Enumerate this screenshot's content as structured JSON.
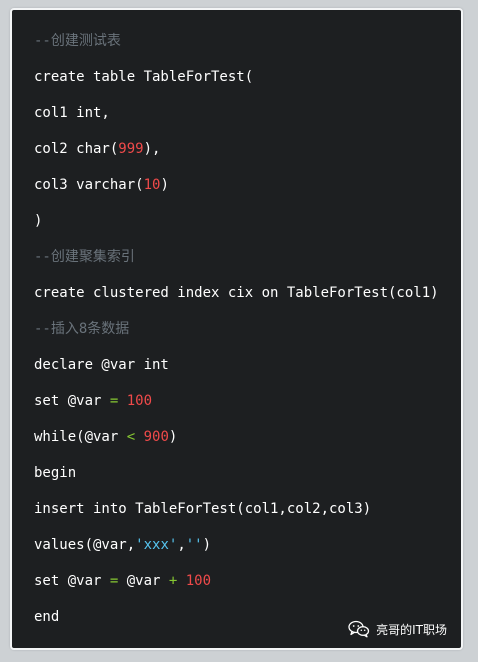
{
  "code": {
    "lines": [
      {
        "segments": [
          {
            "text": "--创建测试表",
            "type": "comment"
          }
        ]
      },
      {
        "segments": [
          {
            "text": "create table TableForTest(",
            "type": "plain"
          }
        ]
      },
      {
        "segments": [
          {
            "text": "col1 int,",
            "type": "plain"
          }
        ]
      },
      {
        "segments": [
          {
            "text": "col2 char(",
            "type": "plain"
          },
          {
            "text": "999",
            "type": "num"
          },
          {
            "text": "),",
            "type": "plain"
          }
        ]
      },
      {
        "segments": [
          {
            "text": "col3 varchar(",
            "type": "plain"
          },
          {
            "text": "10",
            "type": "num"
          },
          {
            "text": ")",
            "type": "plain"
          }
        ]
      },
      {
        "segments": [
          {
            "text": ")",
            "type": "plain"
          }
        ]
      },
      {
        "segments": [
          {
            "text": "--创建聚集索引",
            "type": "comment"
          }
        ]
      },
      {
        "segments": [
          {
            "text": "create clustered index cix on TableForTest(col1)",
            "type": "plain"
          }
        ]
      },
      {
        "segments": [
          {
            "text": "--插入8条数据",
            "type": "comment"
          }
        ]
      },
      {
        "segments": [
          {
            "text": "declare @var int",
            "type": "plain"
          }
        ]
      },
      {
        "segments": [
          {
            "text": "set @var ",
            "type": "plain"
          },
          {
            "text": "=",
            "type": "op"
          },
          {
            "text": " ",
            "type": "plain"
          },
          {
            "text": "100",
            "type": "num"
          }
        ]
      },
      {
        "segments": [
          {
            "text": "while(@var ",
            "type": "plain"
          },
          {
            "text": "<",
            "type": "op"
          },
          {
            "text": " ",
            "type": "plain"
          },
          {
            "text": "900",
            "type": "num"
          },
          {
            "text": ")",
            "type": "plain"
          }
        ]
      },
      {
        "segments": [
          {
            "text": "begin",
            "type": "plain"
          }
        ]
      },
      {
        "segments": [
          {
            "text": "insert into TableForTest(col1,col2,col3)",
            "type": "plain"
          }
        ]
      },
      {
        "segments": [
          {
            "text": "values(@var,",
            "type": "plain"
          },
          {
            "text": "'xxx'",
            "type": "str"
          },
          {
            "text": ",",
            "type": "plain"
          },
          {
            "text": "''",
            "type": "str"
          },
          {
            "text": ")",
            "type": "plain"
          }
        ]
      },
      {
        "segments": [
          {
            "text": "set @var ",
            "type": "plain"
          },
          {
            "text": "=",
            "type": "op"
          },
          {
            "text": " @var ",
            "type": "plain"
          },
          {
            "text": "+",
            "type": "op"
          },
          {
            "text": " ",
            "type": "plain"
          },
          {
            "text": "100",
            "type": "num"
          }
        ]
      },
      {
        "segments": [
          {
            "text": "end",
            "type": "plain"
          }
        ]
      }
    ]
  },
  "watermark": {
    "icon": "wechat-icon",
    "text": "亮哥的IT职场"
  },
  "colors": {
    "background": "#cdd1d4",
    "code_bg": "#1d1f21",
    "comment": "#69727a",
    "number": "#ef4a4a",
    "operator": "#86c832",
    "string": "#56c4ef",
    "plain": "#ffffff"
  }
}
